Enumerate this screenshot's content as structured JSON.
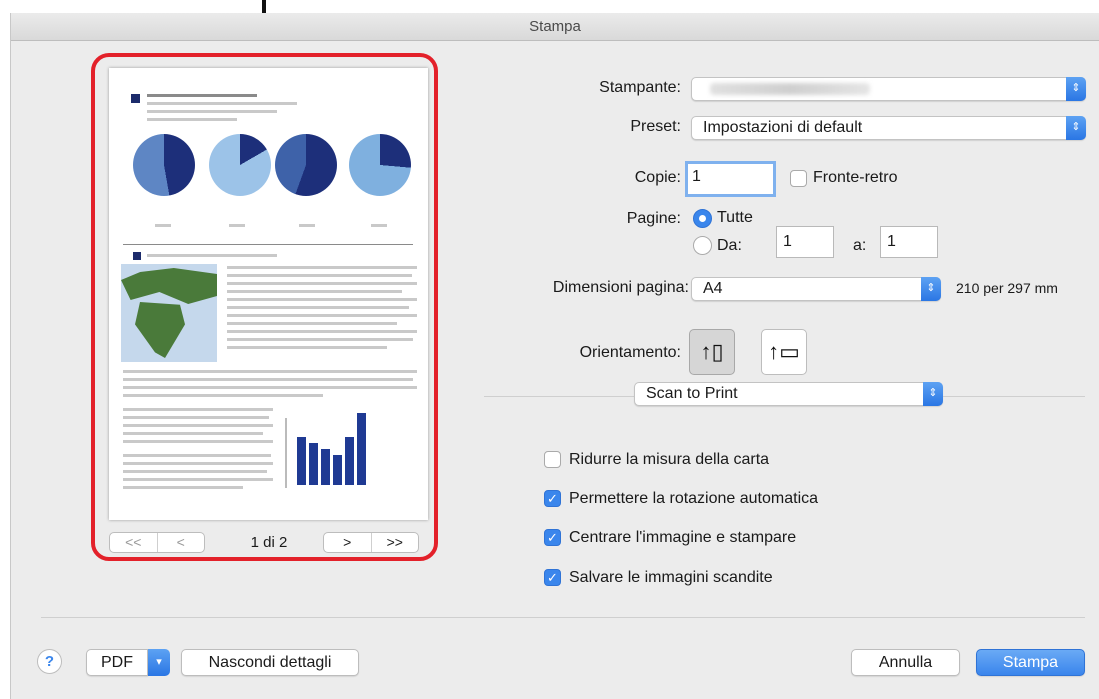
{
  "window": {
    "title": "Stampa"
  },
  "preview": {
    "page_label": "1 di 2",
    "first_glyph": "<<",
    "prev_glyph": "<",
    "next_glyph": ">",
    "last_glyph": ">>"
  },
  "form": {
    "printer_label": "Stampante:",
    "preset_label": "Preset:",
    "preset_value": "Impostazioni di default",
    "copies_label": "Copie:",
    "copies_value": "1",
    "duplex_label": "Fronte-retro",
    "pages_label": "Pagine:",
    "all_label": "Tutte",
    "from_label": "Da:",
    "from_value": "1",
    "to_label": "a:",
    "to_value": "1",
    "paper_size_label": "Dimensioni pagina:",
    "paper_size_value": "A4",
    "paper_size_dims": "210 per 297 mm",
    "orientation_label": "Orientamento:",
    "section_value": "Scan to Print"
  },
  "options": [
    {
      "label": "Ridurre la misura della carta",
      "checked": false
    },
    {
      "label": "Permettere la rotazione automatica",
      "checked": true
    },
    {
      "label": "Centrare l'immagine e stampare",
      "checked": true
    },
    {
      "label": "Salvare le immagini scandite",
      "checked": true
    }
  ],
  "footer": {
    "help_glyph": "?",
    "pdf_label": "PDF",
    "hide_details_label": "Nascondi dettagli",
    "cancel_label": "Annulla",
    "print_label": "Stampa"
  },
  "colors": {
    "accent": "#3a86ec",
    "highlight": "#e3212a"
  }
}
